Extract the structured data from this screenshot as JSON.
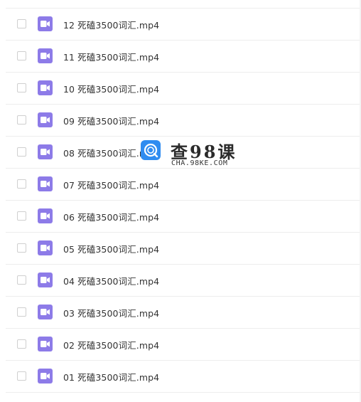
{
  "files": [
    {
      "name": "",
      "icon": "video-file-icon"
    },
    {
      "name": "12 死磕3500词汇.mp4",
      "icon": "video-file-icon"
    },
    {
      "name": "11 死磕3500词汇.mp4",
      "icon": "video-file-icon"
    },
    {
      "name": "10 死磕3500词汇.mp4",
      "icon": "video-file-icon"
    },
    {
      "name": "09 死磕3500词汇.mp4",
      "icon": "video-file-icon"
    },
    {
      "name": "08 死磕3500词汇.mp4",
      "icon": "video-file-icon"
    },
    {
      "name": "07 死磕3500词汇.mp4",
      "icon": "video-file-icon"
    },
    {
      "name": "06 死磕3500词汇.mp4",
      "icon": "video-file-icon"
    },
    {
      "name": "05 死磕3500词汇.mp4",
      "icon": "video-file-icon"
    },
    {
      "name": "04 死磕3500词汇.mp4",
      "icon": "video-file-icon"
    },
    {
      "name": "03 死磕3500词汇.mp4",
      "icon": "video-file-icon"
    },
    {
      "name": "02 死磕3500词汇.mp4",
      "icon": "video-file-icon"
    },
    {
      "name": "01 死磕3500词汇.mp4",
      "icon": "video-file-icon"
    }
  ],
  "watermark": {
    "title": "查98课",
    "subtitle": "CHA.98KE.COM"
  },
  "colors": {
    "file_icon": "#8d7be8",
    "watermark_badge": "#2f8cf0",
    "row_border": "#ededed",
    "text": "#333333"
  }
}
